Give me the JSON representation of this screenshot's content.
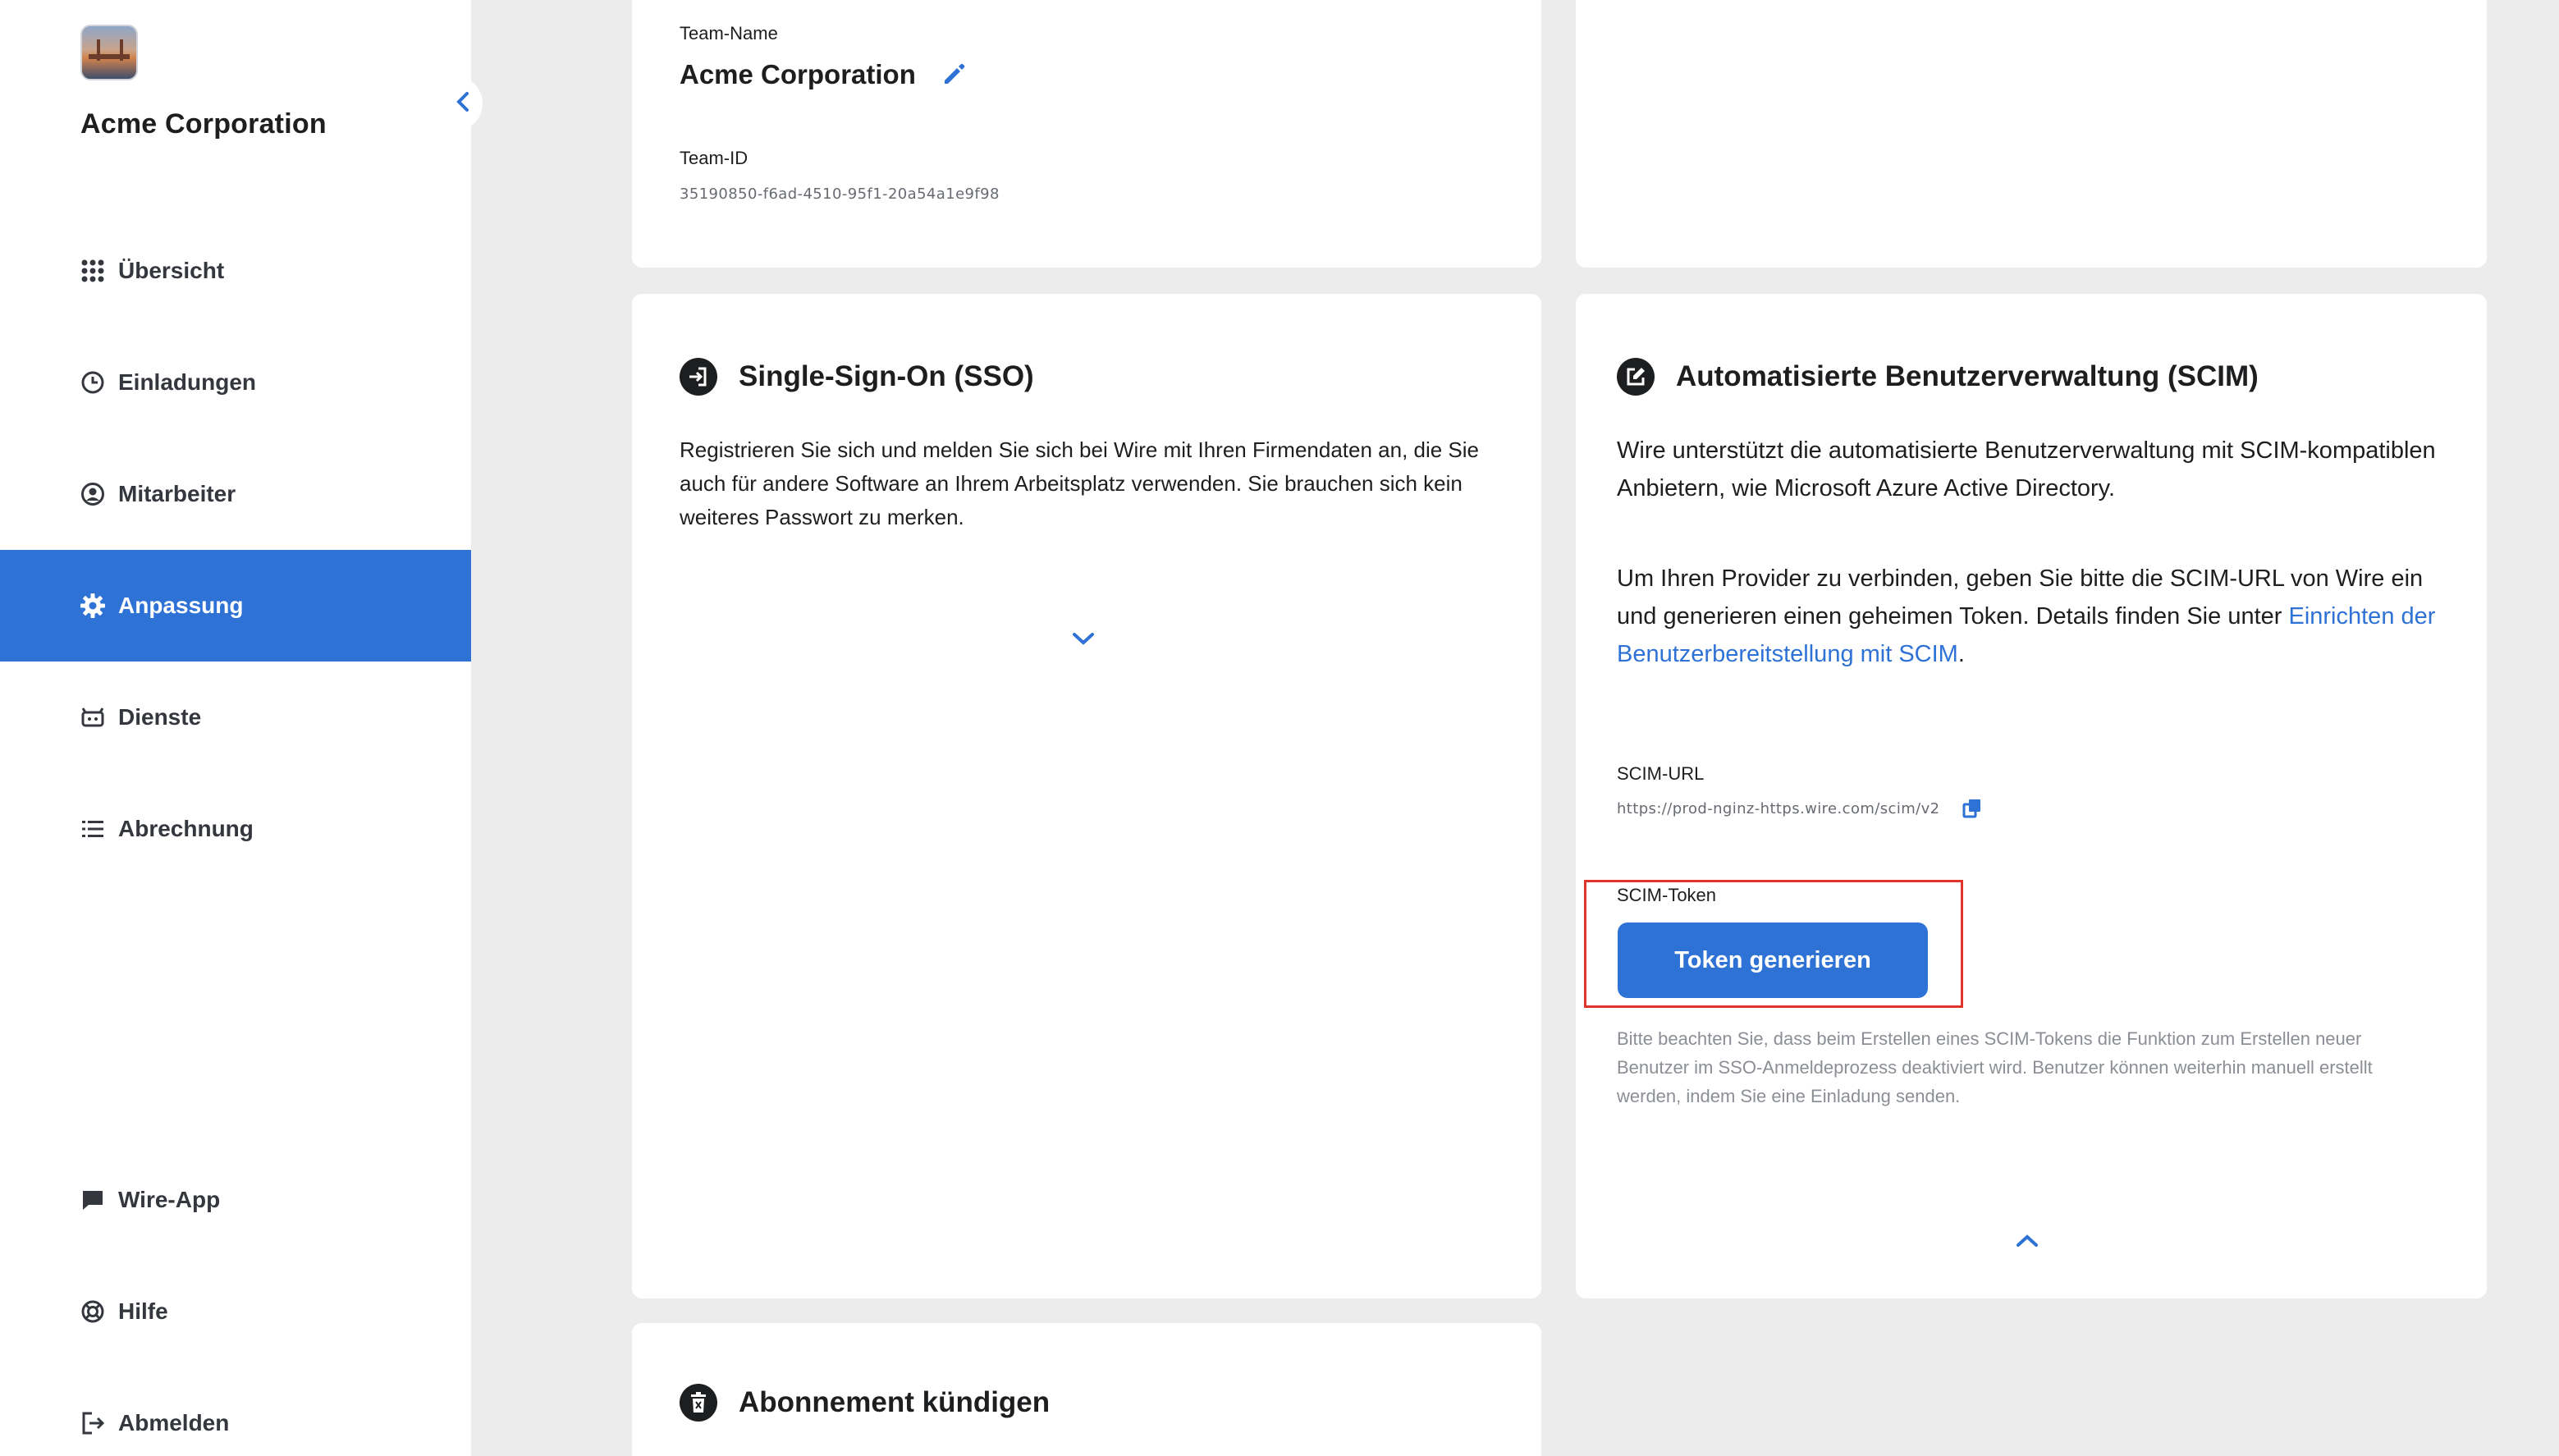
{
  "sidebar": {
    "team_name": "Acme Corporation",
    "items": [
      {
        "label": "Übersicht",
        "icon": "grid-icon"
      },
      {
        "label": "Einladungen",
        "icon": "clock-icon"
      },
      {
        "label": "Mitarbeiter",
        "icon": "user-circle-icon"
      },
      {
        "label": "Anpassung",
        "icon": "gear-icon",
        "active": true
      },
      {
        "label": "Dienste",
        "icon": "bot-icon"
      },
      {
        "label": "Abrechnung",
        "icon": "list-icon"
      }
    ],
    "bottom_items": [
      {
        "label": "Wire-App",
        "icon": "chat-icon"
      },
      {
        "label": "Hilfe",
        "icon": "lifebuoy-icon"
      },
      {
        "label": "Abmelden",
        "icon": "logout-icon"
      }
    ]
  },
  "team_card": {
    "name_label": "Team-Name",
    "name_value": "Acme Corporation",
    "id_label": "Team-ID",
    "id_value": "35190850-f6ad-4510-95f1-20a54a1e9f98"
  },
  "sso_card": {
    "title": "Single-Sign-On (SSO)",
    "description": "Registrieren Sie sich und melden Sie sich bei Wire mit Ihren Firmendaten an, die Sie auch für andere Software an Ihrem Arbeitsplatz verwenden. Sie brauchen sich kein weiteres Passwort zu merken."
  },
  "scim_card": {
    "title": "Automatisierte Benutzerverwaltung (SCIM)",
    "paragraph1": "Wire unterstützt die automatisierte Benutzerverwaltung mit SCIM-kompatiblen Anbietern, wie Microsoft Azure Active Directory.",
    "paragraph2_text": "Um Ihren Provider zu verbinden, geben Sie bitte die SCIM-URL von Wire ein und generieren einen geheimen Token. Details finden Sie unter ",
    "paragraph2_link": "Einrichten der Benutzerbereitstellung mit SCIM",
    "paragraph2_end": ".",
    "url_label": "SCIM-URL",
    "url_value": "https://prod-nginz-https.wire.com/scim/v2",
    "token_label": "SCIM-Token",
    "token_button": "Token generieren",
    "note": "Bitte beachten Sie, dass beim Erstellen eines SCIM-Tokens die Funktion zum Erstellen neuer Benutzer im SSO-Anmeldeprozess deaktiviert wird. Benutzer können weiterhin manuell erstellt werden, indem Sie eine Einladung senden."
  },
  "cancel_card": {
    "title": "Abonnement kündigen"
  },
  "colors": {
    "accent": "#2e72d6",
    "highlight": "#e0352b",
    "background": "#ececec"
  }
}
